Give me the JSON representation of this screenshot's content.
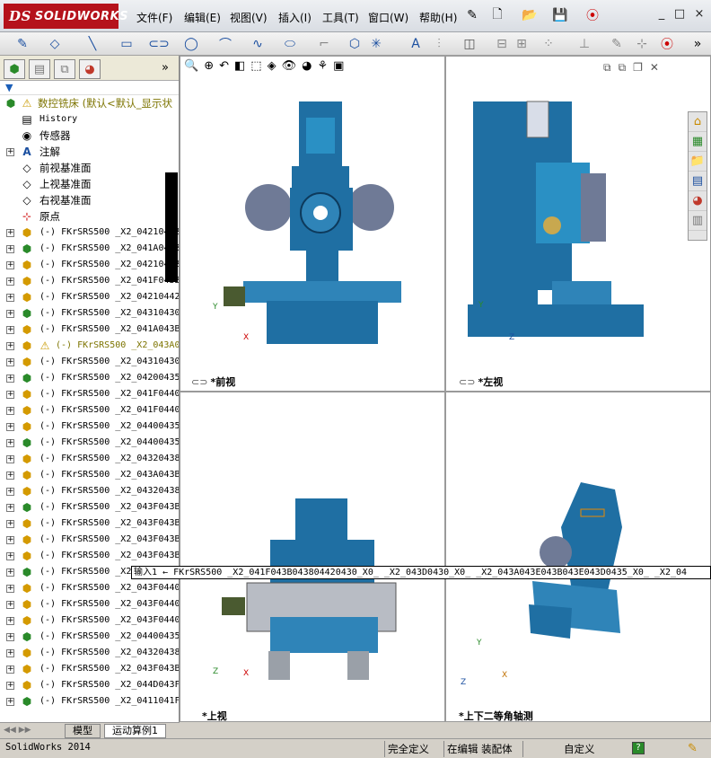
{
  "app": {
    "logo_prefix": "DS",
    "logo_text": "SOLIDWORKS",
    "menus": [
      "文件(F)",
      "编辑(E)",
      "视图(V)",
      "插入(I)",
      "工具(T)",
      "窗口(W)",
      "帮助(H)"
    ],
    "window_buttons": [
      "_",
      "□",
      "×"
    ]
  },
  "toolbar_icons": [
    "new-icon",
    "open-icon",
    "save-icon",
    "print-icon",
    "traffic-light-icon"
  ],
  "left_panel": {
    "filter_symbol": "▼",
    "expand_symbol": "»",
    "root": {
      "label": "数控铣床  (默认<默认_显示状"
    },
    "nodes": [
      {
        "label": "History",
        "icon": "history-icon"
      },
      {
        "label": "传感器",
        "icon": "sensor-icon"
      },
      {
        "label": "注解",
        "icon": "annotation-icon"
      },
      {
        "label": "前视基准面",
        "icon": "plane-icon"
      },
      {
        "label": "上视基准面",
        "icon": "plane-icon"
      },
      {
        "label": "右视基准面",
        "icon": "plane-icon"
      },
      {
        "label": "原点",
        "icon": "origin-icon"
      }
    ],
    "parts": [
      "(-) FKrSRS500 _X2_042104420",
      "(-) FKrSRS500 _X2_041A043B",
      "(-) FKrSRS500 _X2_042104420",
      "(-) FKrSRS500 _X2_041F043B",
      "(-) FKrSRS500 _X2_042104420",
      "(-) FKrSRS500 _X2_04310430",
      "(-) FKrSRS500 _X2_041A043B",
      "(-) FKrSRS500 _X2_043A04",
      "(-) FKrSRS500 _X2_04310430",
      "(-) FKrSRS500 _X2_04200435",
      "(-) FKrSRS500 _X2_041F0440",
      "(-) FKrSRS500 _X2_041F0440",
      "(-) FKrSRS500 _X2_04400435",
      "(-) FKrSRS500 _X2_04400435",
      "(-) FKrSRS500 _X2_04320438",
      "(-) FKrSRS500 _X2_043A043B",
      "(-) FKrSRS500 _X2_04320438",
      "(-) FKrSRS500 _X2_043F043B",
      "(-) FKrSRS500 _X2_043F043B",
      "(-) FKrSRS500 _X2_043F043B",
      "(-) FKrSRS500 _X2_043F043B",
      "(-) FKrSRS500 _X2",
      "(-) FKrSRS500 _X2_043F0440",
      "(-) FKrSRS500 _X2_043F0440",
      "(-) FKrSRS500 _X2_043F0440",
      "(-) FKrSRS500 _X2_04400435",
      "(-) FKrSRS500 _X2_04320438",
      "(-) FKrSRS500 _X2_043F043B",
      "(-) FKrSRS500 _X2_044D043F",
      "(-) FKrSRS500 _X2_0411041F"
    ],
    "warning_part_index": 7
  },
  "viewports": {
    "front": "*前视",
    "left": "*左视",
    "top": "*上视",
    "iso": "*上下二等角轴测"
  },
  "axes": {
    "x": "X",
    "y": "Y",
    "z": "Z"
  },
  "tooltip": "输入1 ← FKrSRS500 _X2_041F043B043804420430_X0_ _X2_043D0430_X0_ _X2_043A043E043B043E043D0435_X0_ _X2_04",
  "bottom_tabs": [
    "模型",
    "运动算例1"
  ],
  "status_bar": {
    "app_name": "SolidWorks 2014",
    "fully_defined": "完全定义",
    "editing": "在编辑 装配体",
    "custom": "自定义",
    "help": "?"
  },
  "colors": {
    "brand": "#b5121b",
    "machine_blue": "#1f6fa3",
    "machine_gray": "#6f7a96"
  }
}
